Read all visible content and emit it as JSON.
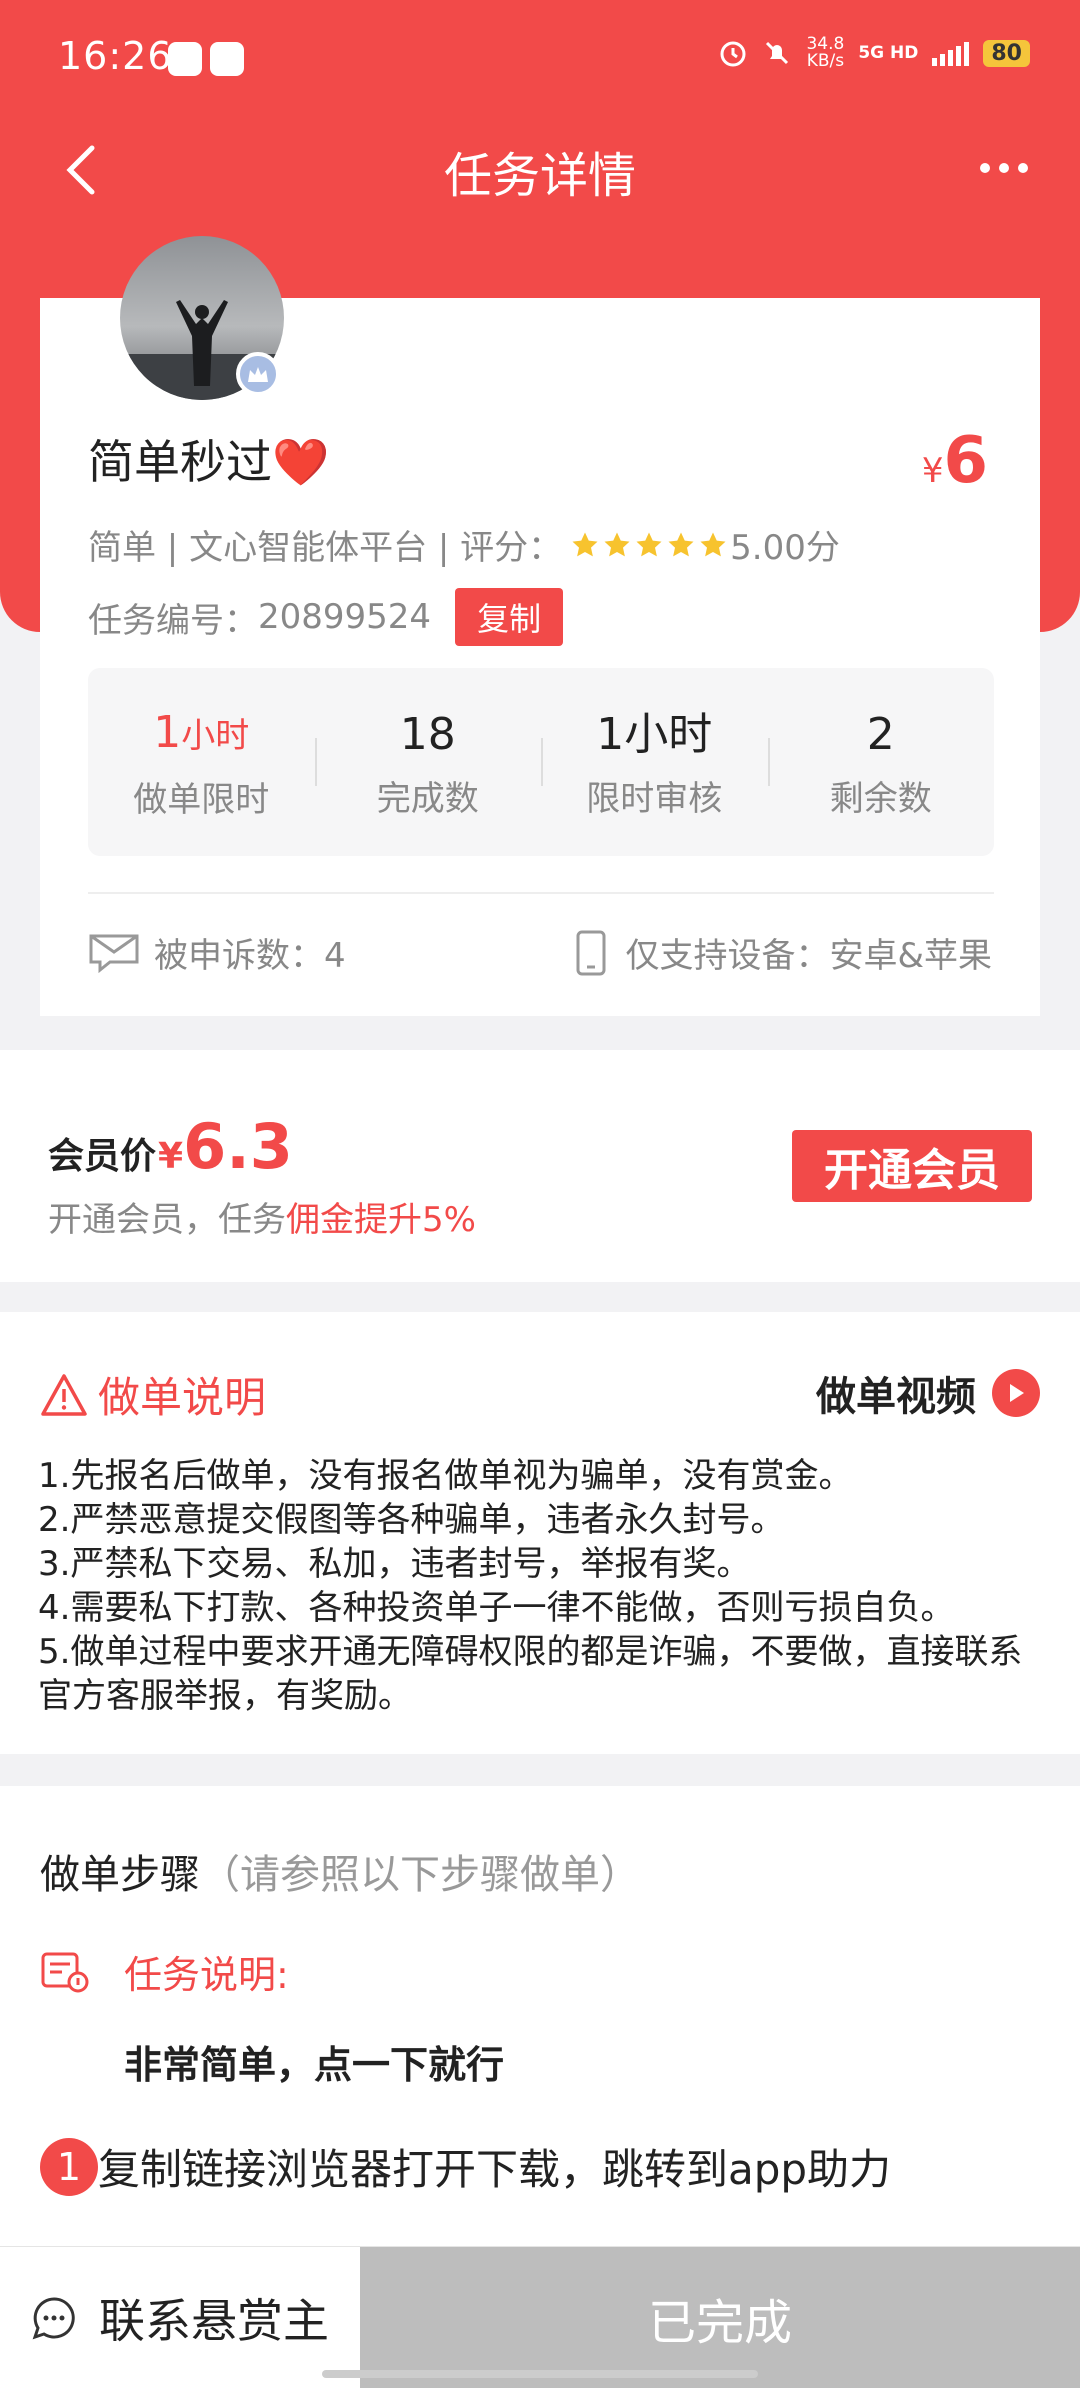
{
  "status_bar": {
    "time": "16:26",
    "net_speed": "34.8",
    "net_unit": "KB/s",
    "signal": "5G HD",
    "battery": "80"
  },
  "nav": {
    "title": "任务详情"
  },
  "task": {
    "title": "简单秒过",
    "title_emoji": "❤️",
    "price_symbol": "¥",
    "price": "6",
    "meta_prefix": "简单 | 文心智能体平台 | 评分：",
    "rating": 5,
    "rating_text": "5.00分",
    "number_label": "任务编号：",
    "number": "20899524",
    "copy_label": "复制",
    "stats": [
      {
        "value": "1",
        "unit": "小时",
        "label": "做单限时"
      },
      {
        "value": "18",
        "unit": "",
        "label": "完成数"
      },
      {
        "value": "1小时",
        "unit": "",
        "label": "限时审核"
      },
      {
        "value": "2",
        "unit": "",
        "label": "剩余数"
      }
    ],
    "complaints": "被申诉数：4",
    "devices": "仅支持设备：安卓&苹果"
  },
  "vip": {
    "label": "会员价",
    "price_symbol": "¥",
    "price": "6.3",
    "desc_prefix": "开通会员，任务",
    "desc_highlight": "佣金提升5%",
    "button": "开通会员"
  },
  "instructions": {
    "heading": "做单说明",
    "video_label": "做单视频",
    "rules": [
      "1.先报名后做单，没有报名做单视为骗单，没有赏金。",
      "2.严禁恶意提交假图等各种骗单，违者永久封号。",
      "3.严禁私下交易、私加，违者封号，举报有奖。",
      "4.需要私下打款、各种投资单子一律不能做，否则亏损自负。",
      "5.做单过程中要求开通无障碍权限的都是诈骗，不要做，直接联系官方客服举报，有奖励。"
    ]
  },
  "steps": {
    "title": "做单步骤",
    "subtitle": "（请参照以下步骤做单）",
    "task_desc_label": "任务说明:",
    "task_desc": "非常简单，点一下就行",
    "step1_num": "1",
    "step1_text": "复制链接浏览器打开下载，跳转到app助力"
  },
  "bottom": {
    "contact": "联系悬赏主",
    "done": "已完成"
  },
  "colors": {
    "accent": "#f24a49",
    "star": "#f7c32e",
    "disabled": "#bdbdbd"
  }
}
